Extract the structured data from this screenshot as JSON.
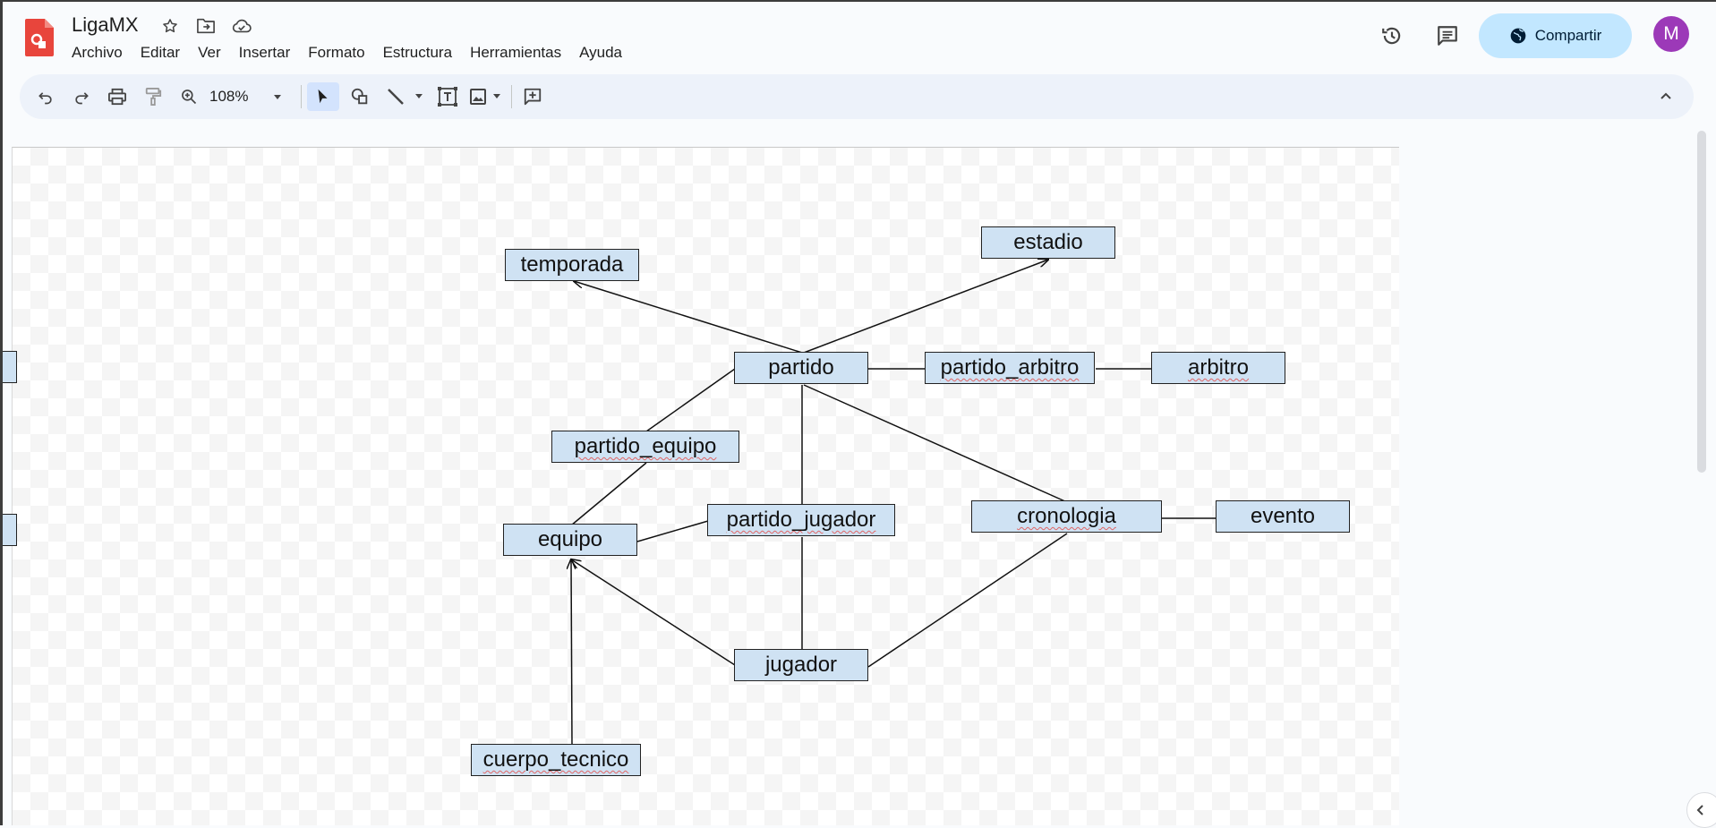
{
  "app": {
    "title": "LigaMX",
    "icon_name": "drawings-app-icon",
    "brand_color": "#e8453c"
  },
  "menu": [
    "Archivo",
    "Editar",
    "Ver",
    "Insertar",
    "Formato",
    "Estructura",
    "Herramientas",
    "Ayuda"
  ],
  "header": {
    "share_label": "Compartir",
    "avatar_letter": "M",
    "avatar_color": "#9c39b8"
  },
  "toolbar": {
    "zoom": "108%"
  },
  "diagram": {
    "nodes": {
      "temporada": "temporada",
      "estadio": "estadio",
      "partido": "partido",
      "partido_arbitro": "partido_arbitro",
      "arbitro": "arbitro",
      "partido_equipo": "partido_equipo",
      "equipo": "equipo",
      "partido_jugador": "partido_jugador",
      "cronologia": "cronologia",
      "evento": "evento",
      "jugador": "jugador",
      "cuerpo_tecnico": "cuerpo_tecnico"
    },
    "node_fill": "#cfe2f3"
  }
}
